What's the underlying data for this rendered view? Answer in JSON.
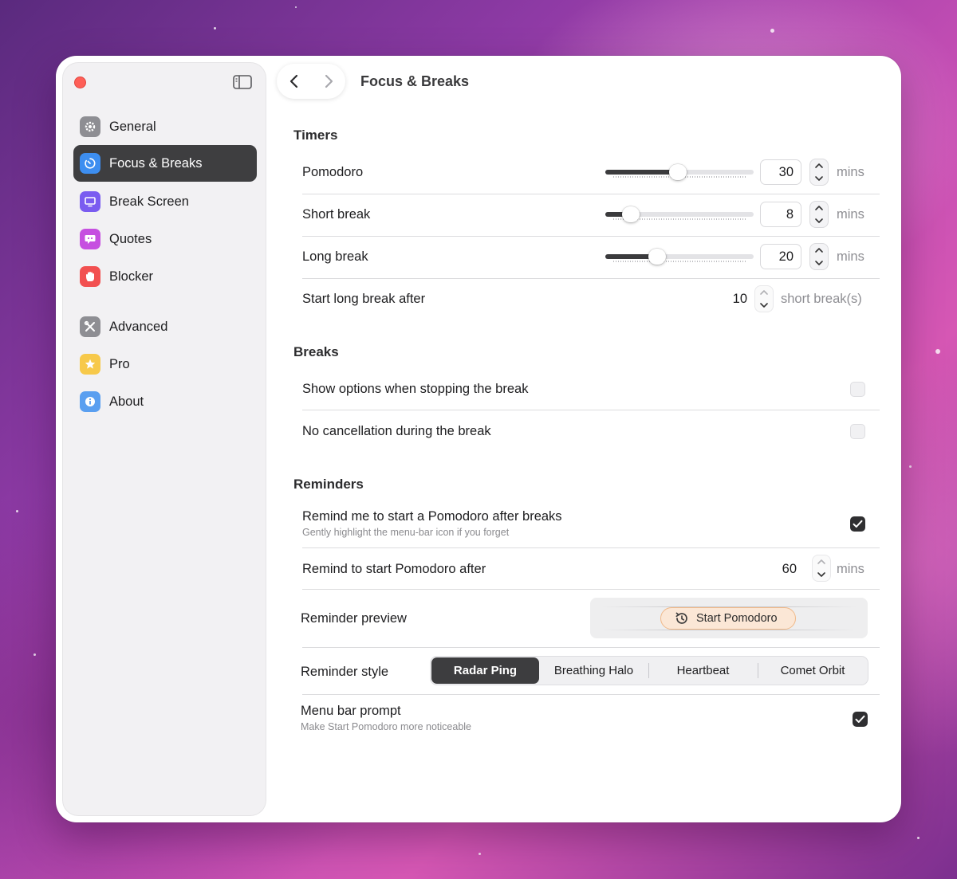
{
  "window": {
    "page_title": "Focus & Breaks"
  },
  "sidebar": {
    "items": [
      {
        "label": "General",
        "icon": "gear-icon",
        "color": "#8e8e93"
      },
      {
        "label": "Focus & Breaks",
        "icon": "timer-icon",
        "color": "#3d8ef0",
        "active": true
      },
      {
        "label": "Break Screen",
        "icon": "display-icon",
        "color": "#7a5cf0"
      },
      {
        "label": "Quotes",
        "icon": "quote-bubble-icon",
        "color": "#c64fe0"
      },
      {
        "label": "Blocker",
        "icon": "hand-icon",
        "color": "#f25050"
      },
      {
        "label": "Advanced",
        "icon": "tools-icon",
        "color": "#8e8e93"
      },
      {
        "label": "Pro",
        "icon": "star-icon",
        "color": "#f7c94a"
      },
      {
        "label": "About",
        "icon": "info-icon",
        "color": "#5a9ff0"
      }
    ]
  },
  "timers": {
    "title": "Timers",
    "pomodoro": {
      "label": "Pomodoro",
      "value": "30",
      "unit": "mins",
      "level": 0.49
    },
    "short_break": {
      "label": "Short break",
      "value": "8",
      "unit": "mins",
      "level": 0.17
    },
    "long_break": {
      "label": "Long break",
      "value": "20",
      "unit": "mins",
      "level": 0.35
    },
    "long_after": {
      "label": "Start long break after",
      "value": "10",
      "unit": "short break(s)"
    }
  },
  "breaks": {
    "title": "Breaks",
    "show_options": {
      "label": "Show options when stopping the break",
      "checked": false
    },
    "no_cancel": {
      "label": "No cancellation during the break",
      "checked": false
    }
  },
  "reminders": {
    "title": "Reminders",
    "remind_start": {
      "label": "Remind me to start a Pomodoro after breaks",
      "sub": "Gently highlight the menu-bar icon if you forget",
      "checked": true
    },
    "remind_after": {
      "label": "Remind to start Pomodoro after",
      "value": "60",
      "unit": "mins"
    },
    "preview": {
      "label": "Reminder preview",
      "button": "Start Pomodoro"
    },
    "style": {
      "label": "Reminder style",
      "options": [
        "Radar Ping",
        "Breathing Halo",
        "Heartbeat",
        "Comet Orbit"
      ],
      "selected": "Radar Ping"
    },
    "menu_bar": {
      "label": "Menu bar prompt",
      "sub": "Make Start Pomodoro more noticeable",
      "checked": true
    }
  }
}
